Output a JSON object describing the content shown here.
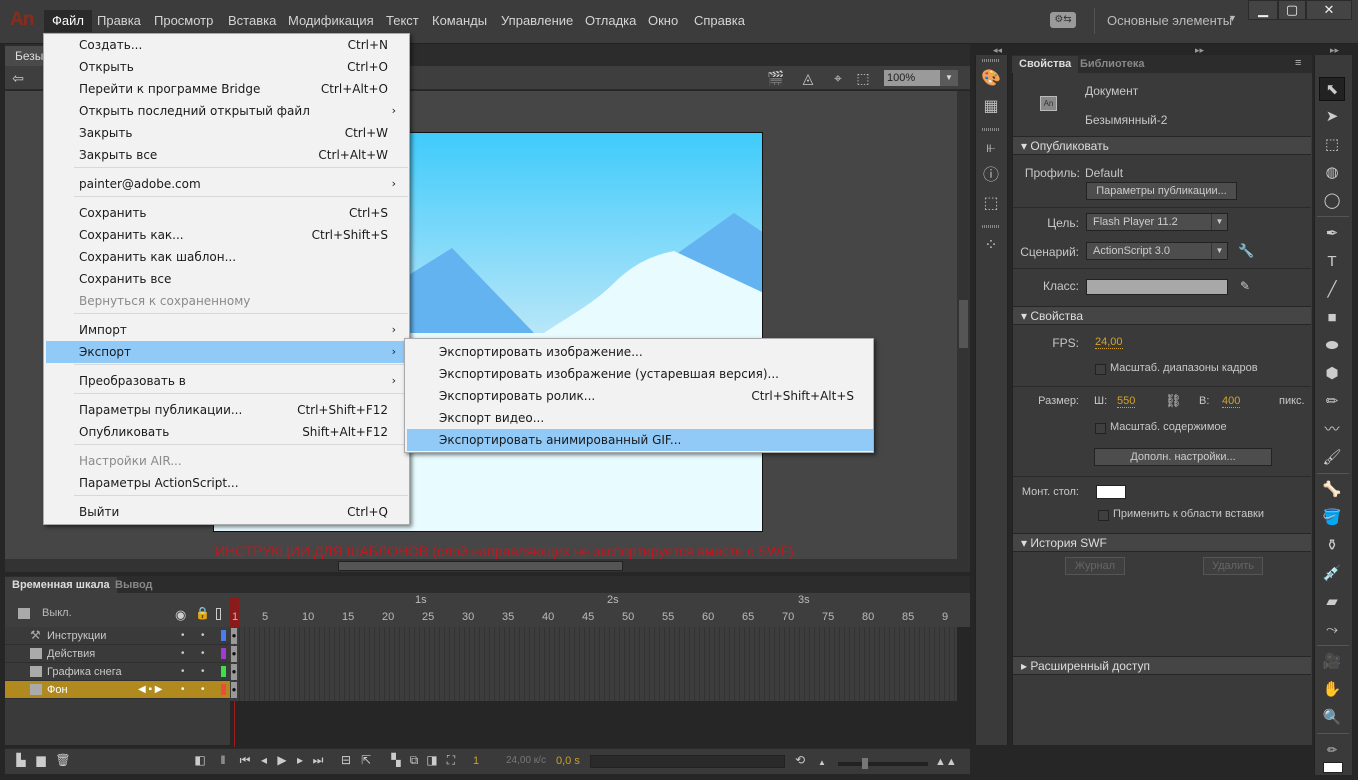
{
  "app": {
    "logo": "An",
    "menus": [
      "Файл",
      "Правка",
      "Просмотр",
      "Вставка",
      "Модификация",
      "Текст",
      "Команды",
      "Управление",
      "Отладка",
      "Окно",
      "Справка"
    ],
    "workspace": "Основные элементы",
    "window_controls": {
      "minimize": "▁",
      "maximize": "▢",
      "close": "✕"
    }
  },
  "document": {
    "tab_label": "Безымянный-2",
    "zoom": "100%",
    "stage_warning": "ИНСТРУКЦИИ ДЛЯ ШАБЛОНОВ (слой направляющих не экспортируется вместе с SWF)",
    "colors": {
      "sky_top": "#3fcbfb",
      "sky_bottom": "#b8e6f8",
      "mountain": "#62b3f0",
      "snow": "#e8fcff"
    }
  },
  "file_menu": {
    "items": [
      {
        "label": "Создать...",
        "shortcut": "Ctrl+N"
      },
      {
        "label": "Открыть",
        "shortcut": "Ctrl+O"
      },
      {
        "label": "Перейти к программе Bridge",
        "shortcut": "Ctrl+Alt+O"
      },
      {
        "label": "Открыть последний открытый файл",
        "submenu": "›"
      },
      {
        "label": "Закрыть",
        "shortcut": "Ctrl+W"
      },
      {
        "label": "Закрыть все",
        "shortcut": "Ctrl+Alt+W"
      },
      {
        "label": "painter@adobe.com",
        "submenu": "›"
      },
      {
        "label": "Сохранить",
        "shortcut": "Ctrl+S"
      },
      {
        "label": "Сохранить как...",
        "shortcut": "Ctrl+Shift+S"
      },
      {
        "label": "Сохранить как шаблон..."
      },
      {
        "label": "Сохранить все"
      },
      {
        "label": "Вернуться к сохраненному",
        "disabled": true
      },
      {
        "label": "Импорт",
        "submenu": "›"
      },
      {
        "label": "Экспорт",
        "submenu": "›",
        "highlighted": true
      },
      {
        "label": "Преобразовать в",
        "submenu": "›"
      },
      {
        "label": "Параметры публикации...",
        "shortcut": "Ctrl+Shift+F12"
      },
      {
        "label": "Опубликовать",
        "shortcut": "Shift+Alt+F12"
      },
      {
        "label": "Настройки AIR...",
        "disabled": true
      },
      {
        "label": "Параметры ActionScript..."
      },
      {
        "label": "Выйти",
        "shortcut": "Ctrl+Q"
      }
    ]
  },
  "export_menu": {
    "items": [
      {
        "label": "Экспортировать изображение..."
      },
      {
        "label": "Экспортировать изображение (устаревшая версия)..."
      },
      {
        "label": "Экспортировать ролик...",
        "shortcut": "Ctrl+Shift+Alt+S"
      },
      {
        "label": "Экспорт видео..."
      },
      {
        "label": "Экспортировать анимированный GIF...",
        "highlighted": true
      }
    ]
  },
  "timeline": {
    "tabs": [
      "Временная шкала",
      "Вывод"
    ],
    "header_label": "Выкл.",
    "seconds": [
      "1s",
      "2s",
      "3s"
    ],
    "frame_numbers": [
      "1",
      "5",
      "10",
      "15",
      "20",
      "25",
      "30",
      "35",
      "40",
      "45",
      "50",
      "55",
      "60",
      "65",
      "70",
      "75",
      "80",
      "85",
      "9"
    ],
    "layers": [
      {
        "name": "Инструкции",
        "color": "#4a7ef0",
        "type": "guide"
      },
      {
        "name": "Действия",
        "color": "#a03ad0",
        "type": "normal"
      },
      {
        "name": "Графика снега",
        "color": "#3be04a",
        "type": "normal"
      },
      {
        "name": "Фон",
        "color": "#f04a3a",
        "type": "normal",
        "selected": true
      }
    ],
    "current_frame": "1",
    "fps": "24,00 к/с",
    "time": "0,0 s"
  },
  "properties": {
    "tabs": [
      "Свойства",
      "Библиотека"
    ],
    "doc_type": "Документ",
    "doc_name": "Безымянный-2",
    "publish": {
      "header": "Опубликовать",
      "profile_label": "Профиль:",
      "profile_value": "Default",
      "settings_button": "Параметры публикации...",
      "target_label": "Цель:",
      "target_value": "Flash Player 11.2",
      "script_label": "Сценарий:",
      "script_value": "ActionScript 3.0",
      "class_label": "Класс:",
      "class_value": ""
    },
    "props": {
      "header": "Свойства",
      "fps_label": "FPS:",
      "fps_value": "24,00",
      "scale_spans_label": "Масштаб. диапазоны кадров",
      "size_label": "Размер:",
      "width_label": "Ш:",
      "width_value": "550",
      "height_label": "В:",
      "height_value": "400",
      "unit": "пикс.",
      "scale_content_label": "Масштаб. содержимое",
      "advanced_button": "Дополн. настройки...",
      "stage_label": "Монт. стол:",
      "stage_color": "#ffffff",
      "apply_paste_label": "Применить к области вставки"
    },
    "swf_history": {
      "header": "История SWF",
      "log_button": "Журнал",
      "delete_button": "Удалить"
    },
    "advanced_access": {
      "header": "Расширенный доступ"
    }
  }
}
